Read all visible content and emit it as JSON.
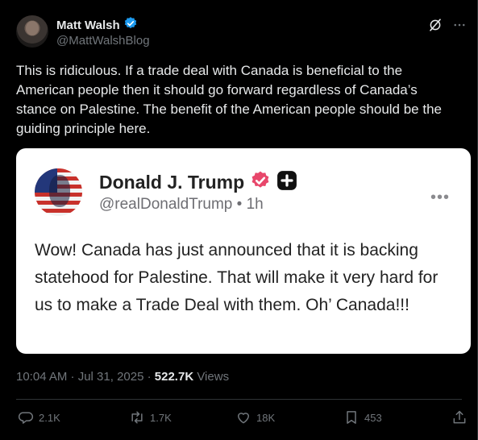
{
  "author": {
    "name": "Matt Walsh",
    "handle": "@MattWalshBlog",
    "verified": true
  },
  "tweet": {
    "text": "This is ridiculous. If a trade deal with Canada is beneficial to the\nAmerican people then it should go forward regardless of Canada’s\nstance on Palestine. The benefit of the American people should be the\nguiding principle here."
  },
  "embedded_post": {
    "name": "Donald J. Trump",
    "handle_time": "@realDonaldTrump • 1h",
    "more": "•••",
    "text": "Wow! Canada has just announced that it is backing statehood for Palestine. That will make it very hard for us to make a Trade Deal with them. Oh’ Canada!!!"
  },
  "meta": {
    "timestamp": "10:04 AM · Jul 31, 2025 · ",
    "views_count": "522.7K",
    "views_label": " Views"
  },
  "actions": {
    "replies": "2.1K",
    "reposts": "1.7K",
    "likes": "18K",
    "bookmarks": "453"
  },
  "colors": {
    "background": "#000000",
    "text": "#e7e9ea",
    "muted": "#71767b",
    "verified_blue": "#1d9bf0",
    "truth_badge_pink": "#e8476b"
  }
}
